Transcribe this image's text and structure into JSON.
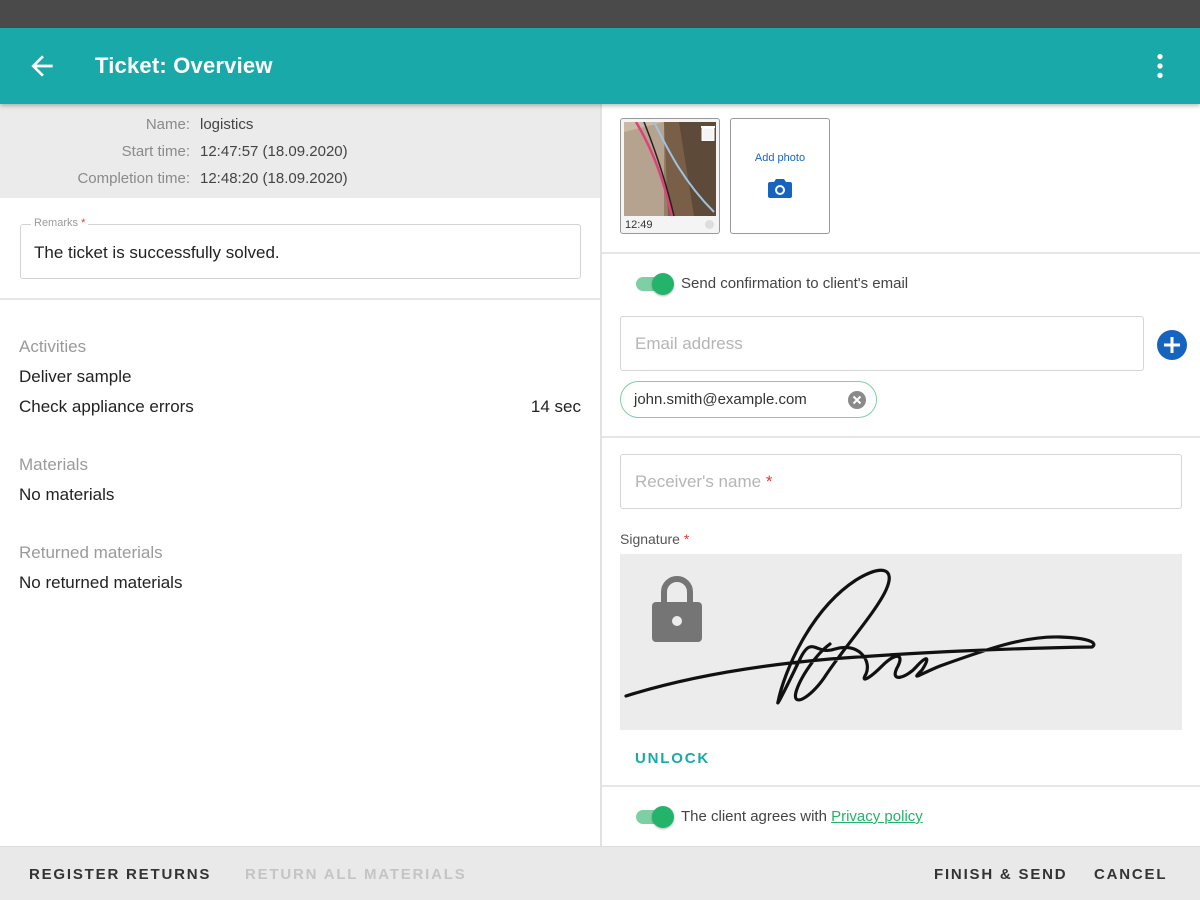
{
  "appbar": {
    "title": "Ticket: Overview"
  },
  "ticket_info": {
    "name_label": "Name:",
    "name_value": "logistics",
    "start_label": "Start time:",
    "start_value": "12:47:57 (18.09.2020)",
    "completion_label": "Completion time:",
    "completion_value": "12:48:20 (18.09.2020)"
  },
  "remarks": {
    "label": "Remarks",
    "required_mark": "*",
    "value": "The ticket is successfully solved."
  },
  "activities": {
    "heading": "Activities",
    "items": [
      {
        "name": "Deliver sample",
        "duration": ""
      },
      {
        "name": "Check appliance errors",
        "duration": "14 sec"
      }
    ]
  },
  "materials": {
    "heading": "Materials",
    "value": "No materials"
  },
  "returned_materials": {
    "heading": "Returned materials",
    "value": "No returned materials"
  },
  "photos": {
    "thumb_time": "12:49",
    "add_label": "Add photo"
  },
  "email_confirmation": {
    "toggle_label": "Send confirmation to client's email",
    "toggle_on": true,
    "email_placeholder": "Email address",
    "chips": [
      "john.smith@example.com"
    ]
  },
  "receiver": {
    "placeholder": "Receiver's name",
    "required_mark": "*"
  },
  "signature": {
    "label": "Signature",
    "required_mark": "*",
    "unlock_label": "UNLOCK"
  },
  "privacy": {
    "label": "The client agrees with",
    "link_text": "Privacy policy",
    "toggle_on": true
  },
  "bottom_bar": {
    "register_returns": "REGISTER RETURNS",
    "return_all": "RETURN ALL MATERIALS",
    "finish_send": "FINISH & SEND",
    "cancel": "CANCEL"
  },
  "colors": {
    "appbar": "#1aa9a9",
    "accent_green": "#23b36b",
    "link_blue": "#1565c0",
    "required_red": "#e53935"
  }
}
